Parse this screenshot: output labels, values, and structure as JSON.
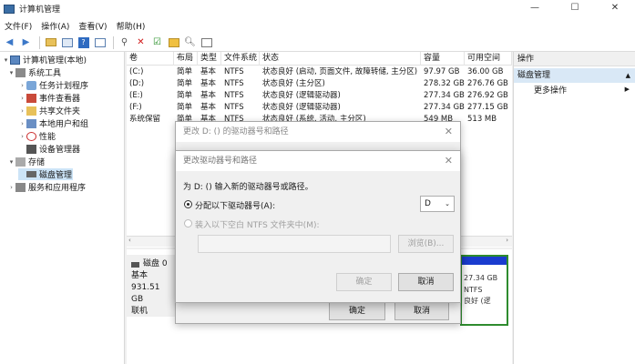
{
  "window": {
    "title": "计算机管理"
  },
  "menu": [
    "文件(F)",
    "操作(A)",
    "查看(V)",
    "帮助(H)"
  ],
  "tree": {
    "root": "计算机管理(本地)",
    "system_tools": "系统工具",
    "task_scheduler": "任务计划程序",
    "event_viewer": "事件查看器",
    "shared_folders": "共享文件夹",
    "local_users": "本地用户和组",
    "performance": "性能",
    "device_manager": "设备管理器",
    "storage": "存储",
    "disk_management": "磁盘管理",
    "services_apps": "服务和应用程序"
  },
  "table": {
    "headers": [
      "卷",
      "布局",
      "类型",
      "文件系统",
      "状态",
      "容量",
      "可用空间"
    ],
    "rows": [
      [
        "(C:)",
        "简单",
        "基本",
        "NTFS",
        "状态良好 (启动, 页面文件, 故障转储, 主分区)",
        "97.97 GB",
        "36.00 GB"
      ],
      [
        "(D:)",
        "简单",
        "基本",
        "NTFS",
        "状态良好 (主分区)",
        "278.32 GB",
        "276.76 GB"
      ],
      [
        "(E:)",
        "简单",
        "基本",
        "NTFS",
        "状态良好 (逻辑驱动器)",
        "277.34 GB",
        "276.92 GB"
      ],
      [
        "(F:)",
        "简单",
        "基本",
        "NTFS",
        "状态良好 (逻辑驱动器)",
        "277.34 GB",
        "277.15 GB"
      ],
      [
        "系统保留",
        "简单",
        "基本",
        "NTFS",
        "状态良好 (系统, 活动, 主分区)",
        "549 MB",
        "513 MB"
      ]
    ]
  },
  "disk": {
    "name": "磁盘 0",
    "type": "基本",
    "size": "931.51 GB",
    "status": "联机",
    "partial_text": "27.34 GB NTFS",
    "partial_text2": "良好 (逻"
  },
  "ops": {
    "header": "操作",
    "selected": "磁盘管理",
    "more": "更多操作"
  },
  "dialog1": {
    "title": "更改 D: () 的驱动器号和路径",
    "ok": "确定",
    "cancel": "取消"
  },
  "dialog2": {
    "title": "更改驱动器号和路径",
    "prompt": "为 D: () 输入新的驱动器号或路径。",
    "opt_letter": "分配以下驱动器号(A):",
    "letter_value": "D",
    "opt_folder": "装入以下空白 NTFS 文件夹中(M):",
    "browse": "浏览(B)...",
    "ok": "确定",
    "cancel": "取消"
  },
  "colors": {
    "selection": "#cce4f7",
    "disk_bar": "#1a3ccf",
    "partition_border": "#2e8b2e"
  }
}
